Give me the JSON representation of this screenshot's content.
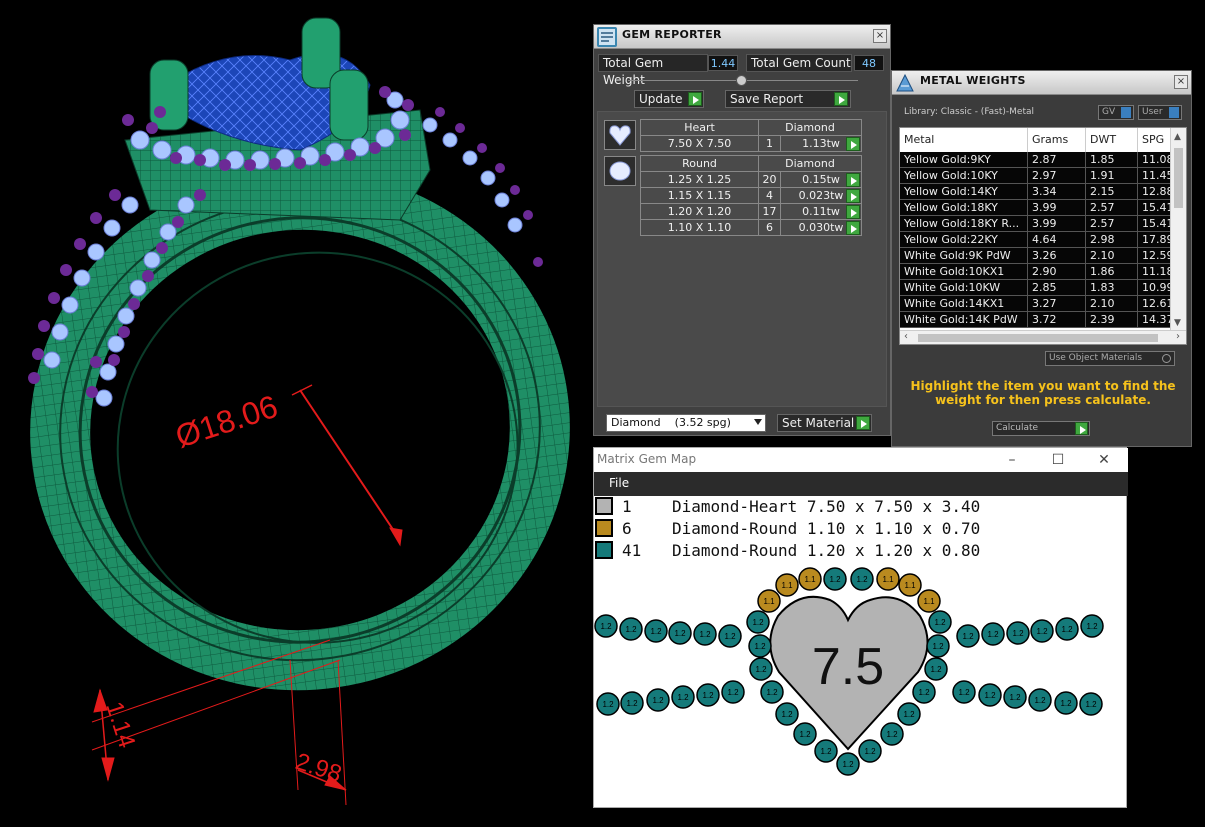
{
  "viewport": {
    "dimension_diameter": "Ø18.06",
    "dimension_width": "1.14",
    "dimension_depth": "2.98"
  },
  "gem_reporter": {
    "title": "GEM REPORTER",
    "close": "×",
    "total_weight_label": "Total Gem Weight",
    "total_weight_value": "1.44",
    "total_count_label": "Total Gem Count",
    "total_count_value": "48",
    "update_label": "Update",
    "save_report_label": "Save Report",
    "groups": [
      {
        "shape": "Heart",
        "material": "Diamond",
        "rows": [
          {
            "size": "7.50 X 7.50",
            "count": "1",
            "weight": "1.13tw"
          }
        ]
      },
      {
        "shape": "Round",
        "material": "Diamond",
        "rows": [
          {
            "size": "1.25 X 1.25",
            "count": "20",
            "weight": "0.15tw"
          },
          {
            "size": "1.15 X 1.15",
            "count": "4",
            "weight": "0.023tw"
          },
          {
            "size": "1.20 X 1.20",
            "count": "17",
            "weight": "0.11tw"
          },
          {
            "size": "1.10 X 1.10",
            "count": "6",
            "weight": "0.030tw"
          }
        ]
      }
    ],
    "material_select": "Diamond    (3.52 spg)",
    "set_material_label": "Set Material"
  },
  "metal_weights": {
    "title": "METAL WEIGHTS",
    "close": "×",
    "library": "Library: Classic - (Fast)-Metal",
    "gv_label": "GV",
    "user_label": "User",
    "columns": [
      "Metal",
      "Grams",
      "DWT",
      "SPG"
    ],
    "rows": [
      [
        "Yellow Gold:9KY",
        "2.87",
        "1.85",
        "11.08"
      ],
      [
        "Yellow Gold:10KY",
        "2.97",
        "1.91",
        "11.45"
      ],
      [
        "Yellow Gold:14KY",
        "3.34",
        "2.15",
        "12.88"
      ],
      [
        "Yellow Gold:18KY",
        "3.99",
        "2.57",
        "15.41"
      ],
      [
        "Yellow Gold:18KY R...",
        "3.99",
        "2.57",
        "15.41"
      ],
      [
        "Yellow Gold:22KY",
        "4.64",
        "2.98",
        "17.89"
      ],
      [
        "White Gold:9K PdW",
        "3.26",
        "2.10",
        "12.59"
      ],
      [
        "White Gold:10KX1",
        "2.90",
        "1.86",
        "11.18"
      ],
      [
        "White Gold:10KW",
        "2.85",
        "1.83",
        "10.99"
      ],
      [
        "White Gold:14KX1",
        "3.27",
        "2.10",
        "12.61"
      ],
      [
        "White Gold:14K PdW",
        "3.72",
        "2.39",
        "14.37"
      ]
    ],
    "use_object_materials": "Use Object Materials",
    "hint": "Highlight the item you want to find the weight for then press calculate.",
    "calculate_label": "Calculate"
  },
  "gem_map": {
    "title": "Matrix Gem Map",
    "menu_file": "File",
    "legend": [
      {
        "count": "1",
        "desc": "Diamond-Heart 7.50 x 7.50 x 3.40",
        "color": "#b3b3b3"
      },
      {
        "count": "6",
        "desc": "Diamond-Round 1.10 x 1.10 x 0.70",
        "color": "#b98a1f"
      },
      {
        "count": "41",
        "desc": "Diamond-Round 1.20 x 1.20 x 0.80",
        "color": "#157a7a"
      }
    ],
    "center_label": "7.5",
    "small_label_gold": "1.1",
    "small_label_teal": "1.2"
  }
}
